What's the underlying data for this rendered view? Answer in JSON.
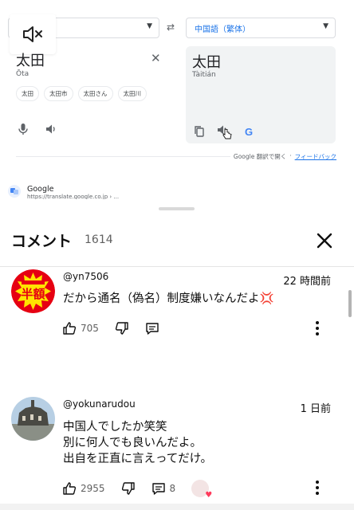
{
  "translate": {
    "target_lang": "中国語（繁体）",
    "swap_symbol": "⇄",
    "source_text": "太田",
    "source_romanization": "Ōta",
    "suggestions": [
      "太田",
      "太田市",
      "太田さん",
      "太田川"
    ],
    "target_text": "太田",
    "target_romanization": "Tàitián",
    "google_logo": "G",
    "open_in_translate": "Google 翻訳で開く",
    "feedback": "フィードバック",
    "separator": "·"
  },
  "search_result": {
    "title": "Google",
    "url": "https://translate.google.co.jp › ..."
  },
  "comments_panel": {
    "title": "コメント",
    "count": "1614",
    "comments": [
      {
        "author": "@yn7506",
        "time": "22 時間前",
        "lines": [
          "だから通名（偽名）制度嫌いなんだよ💢"
        ],
        "likes": "705",
        "avatar_text": "半額",
        "avatar_colors": {
          "bg": "#ffe400",
          "ring": "#e60012"
        }
      },
      {
        "author": "@yokunarudou",
        "time": "1 日前",
        "lines": [
          "中国人でしたか笑笑",
          "別に何人でも良いんだよ。",
          "出自を正直に言えってだけ。"
        ],
        "likes": "2955",
        "replies": "8"
      }
    ]
  },
  "colors": {
    "link_blue": "#1a73e8",
    "heart": "#ff3b5c",
    "text_secondary": "#606060"
  },
  "icons": [
    "mute-icon",
    "mic-icon",
    "speaker-icon",
    "copy-icon",
    "cursor-hand-icon",
    "close-icon",
    "thumbs-up-icon",
    "thumbs-down-icon",
    "reply-icon",
    "more-vert-icon",
    "heart-icon"
  ]
}
